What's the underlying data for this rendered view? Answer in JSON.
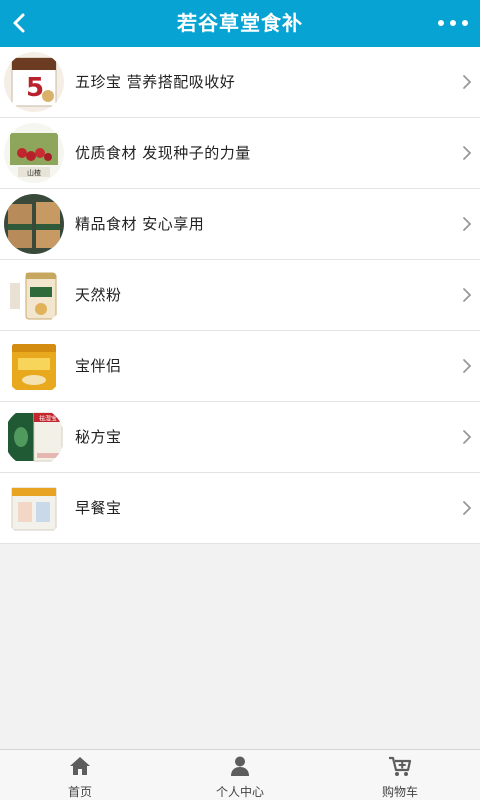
{
  "header": {
    "title": "若谷草堂食补"
  },
  "products": [
    {
      "label": "五珍宝 营养搭配吸收好",
      "thumb_text": "5",
      "icon": "five-treasure-package-image"
    },
    {
      "label": "优质食材 发现种子的力量",
      "thumb_text": "山楂",
      "icon": "hawthorn-image"
    },
    {
      "label": "精品食材 安心享用",
      "thumb_text": "",
      "icon": "gift-box-image"
    },
    {
      "label": "天然粉",
      "thumb_text": "",
      "icon": "powder-can-image"
    },
    {
      "label": "宝伴侣",
      "thumb_text": "",
      "icon": "companion-box-image"
    },
    {
      "label": "秘方宝",
      "thumb_text": "祛湿宝",
      "icon": "recipe-box-image"
    },
    {
      "label": "早餐宝",
      "thumb_text": "",
      "icon": "breakfast-box-image"
    }
  ],
  "tabbar": {
    "home": "首页",
    "profile": "个人中心",
    "cart": "购物车"
  },
  "colors": {
    "header": "#06a3d3",
    "background": "#f2f2f2"
  }
}
